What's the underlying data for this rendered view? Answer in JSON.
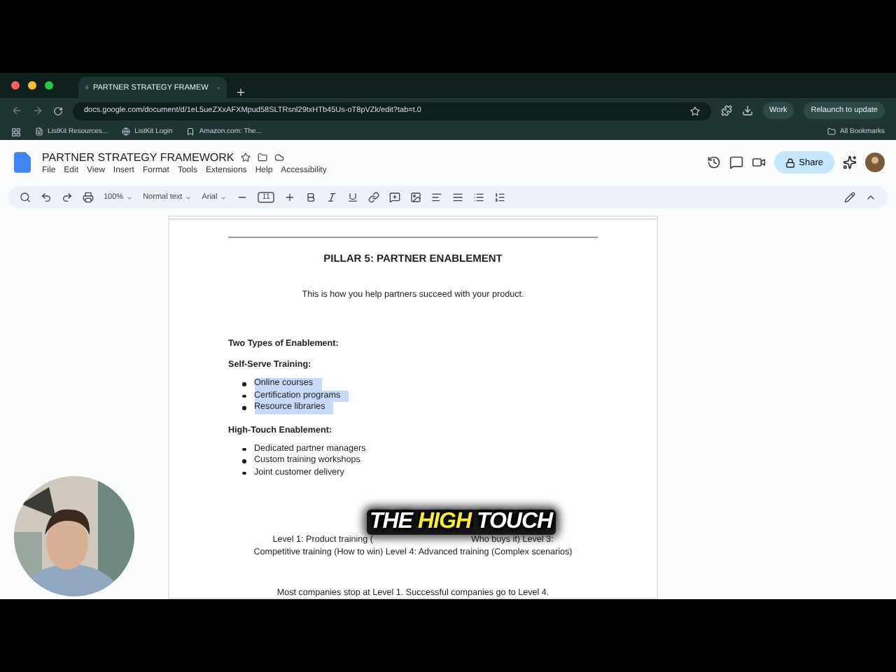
{
  "browser": {
    "tab_title": "PARTNER STRATEGY FRAMEW",
    "url": "docs.google.com/document/d/1eL5ueZXxAFXMpud58SLTRsnl29txHTb45Us-oT8pVZk/edit?tab=t.0",
    "profile": "Work",
    "relaunch": "Relaunch to update",
    "bookmarks": [
      "ListKit Resources...",
      "ListKit Login",
      "Amazon.com: The..."
    ],
    "all_bookmarks": "All Bookmarks"
  },
  "doc_header": {
    "title": "PARTNER STRATEGY FRAMEWORK",
    "menus": [
      "File",
      "Edit",
      "View",
      "Insert",
      "Format",
      "Tools",
      "Extensions",
      "Help",
      "Accessibility"
    ],
    "share": "Share"
  },
  "toolbar": {
    "zoom": "100%",
    "style": "Normal text",
    "font": "Arial",
    "font_size": "11"
  },
  "document": {
    "heading": "PILLAR 5: PARTNER ENABLEMENT",
    "intro": "This is how you help partners succeed with your product.",
    "blocks": [
      {
        "kind": "label",
        "text": "Two Types of Enablement:"
      },
      {
        "kind": "label",
        "text": "Self-Serve Training:"
      },
      {
        "kind": "list",
        "items": [
          {
            "text": "Online courses",
            "selected": true
          },
          {
            "text": "Certification programs",
            "selected": true
          },
          {
            "text": "Resource libraries",
            "selected": true
          }
        ]
      },
      {
        "kind": "label",
        "text": "High-Touch Enablement:"
      },
      {
        "kind": "list",
        "items": [
          {
            "text": "Dedicated partner managers",
            "selected": false
          },
          {
            "text": "Custom training workshops",
            "selected": false
          },
          {
            "text": "Joint customer delivery",
            "selected": false
          }
        ]
      }
    ],
    "levels_start": "Level 1: Product training (",
    "levels_end": "Who buys it) Level 3:",
    "levels_line2": "Competitive training (How to win) Level 4: Advanced training (Complex scenarios)",
    "closing": "Most companies stop at Level 1. Successful companies go to Level 4."
  },
  "caption": [
    {
      "text": "THE",
      "highlight": false
    },
    {
      "text": "HIGH",
      "highlight": true
    },
    {
      "text": "TOUCH",
      "highlight": false
    }
  ]
}
